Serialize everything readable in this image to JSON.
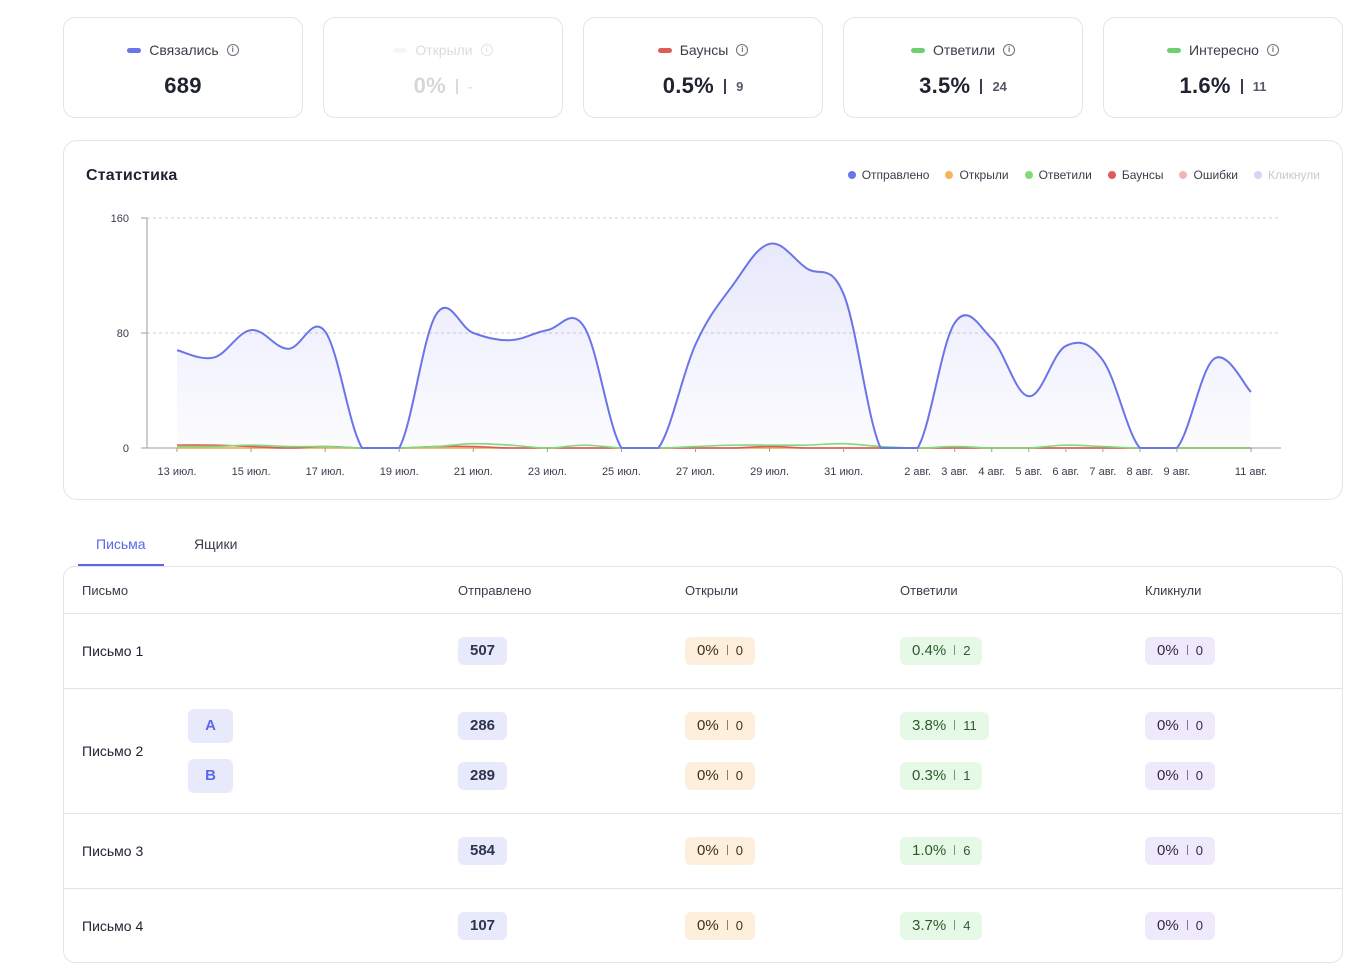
{
  "kpis": [
    {
      "label": "Связались",
      "value": "689",
      "count": "",
      "color": "#6b74e8",
      "faded": false
    },
    {
      "label": "Открыли",
      "value": "0%",
      "count": "-",
      "color": "#f3c8a8",
      "faded": true
    },
    {
      "label": "Баунсы",
      "value": "0.5%",
      "count": "9",
      "color": "#e05a5a",
      "faded": false
    },
    {
      "label": "Ответили",
      "value": "3.5%",
      "count": "24",
      "color": "#6fd06f",
      "faded": false
    },
    {
      "label": "Интересно",
      "value": "1.6%",
      "count": "11",
      "color": "#6fd06f",
      "faded": false
    }
  ],
  "chart": {
    "title": "Статистика",
    "legend": [
      {
        "label": "Отправлено",
        "color": "#6b74e8",
        "faded": false
      },
      {
        "label": "Открыли",
        "color": "#f5b35c",
        "faded": false
      },
      {
        "label": "Ответили",
        "color": "#7fdc74",
        "faded": false
      },
      {
        "label": "Баунсы",
        "color": "#e05a5a",
        "faded": false
      },
      {
        "label": "Ошибки",
        "color": "#f4b4b4",
        "faded": false
      },
      {
        "label": "Кликнули",
        "color": "#d9d4f5",
        "faded": true
      }
    ]
  },
  "chart_data": {
    "type": "area",
    "title": "Статистика",
    "xlabel": "",
    "ylabel": "",
    "ylim": [
      0,
      160
    ],
    "yticks": [
      "0",
      "80",
      "160"
    ],
    "grid": true,
    "legend_position": "top-right",
    "x": [
      "13 июл.",
      "14 июл.",
      "15 июл.",
      "16 июл.",
      "17 июл.",
      "18 июл.",
      "19 июл.",
      "20 июл.",
      "21 июл.",
      "22 июл.",
      "23 июл.",
      "24 июл.",
      "25 июл.",
      "26 июл.",
      "27 июл.",
      "28 июл.",
      "29 июл.",
      "30 июл.",
      "31 июл.",
      "1 авг.",
      "2 авг.",
      "3 авг.",
      "4 авг.",
      "5 авг.",
      "6 авг.",
      "7 авг.",
      "8 авг.",
      "9 авг.",
      "10 авг.",
      "11 авг."
    ],
    "xtick_labels": [
      "13 июл.",
      "15 июл.",
      "17 июл.",
      "19 июл.",
      "21 июл.",
      "23 июл.",
      "25 июл.",
      "27 июл.",
      "29 июл.",
      "31 июл.",
      "2 авг.",
      "3 авг.",
      "4 авг.",
      "5 авг.",
      "6 авг.",
      "7 авг.",
      "8 авг.",
      "9 авг.",
      "11 авг."
    ],
    "series": [
      {
        "name": "Отправлено",
        "color": "#6b74e8",
        "values": [
          68,
          63,
          82,
          69,
          81,
          0,
          0,
          93,
          80,
          75,
          82,
          84,
          0,
          0,
          72,
          113,
          142,
          125,
          107,
          0,
          0,
          87,
          76,
          36,
          71,
          61,
          0,
          0,
          62,
          39
        ]
      },
      {
        "name": "Открыли",
        "color": "#f5b35c",
        "values": [
          0,
          0,
          0,
          0,
          0,
          0,
          0,
          0,
          0,
          0,
          0,
          0,
          0,
          0,
          0,
          0,
          0,
          0,
          0,
          0,
          0,
          0,
          0,
          0,
          0,
          0,
          0,
          0,
          0,
          0
        ]
      },
      {
        "name": "Ответили",
        "color": "#7fdc74",
        "values": [
          1,
          1,
          2,
          1,
          1,
          0,
          0,
          1,
          3,
          2,
          0,
          2,
          0,
          0,
          1,
          2,
          2,
          2,
          3,
          1,
          0,
          1,
          0,
          0,
          2,
          1,
          0,
          0,
          0,
          0
        ]
      },
      {
        "name": "Баунсы",
        "color": "#e05a5a",
        "values": [
          2,
          2,
          1,
          0,
          1,
          0,
          0,
          1,
          1,
          0,
          0,
          0,
          0,
          0,
          0,
          0,
          1,
          0,
          0,
          0,
          0,
          0,
          0,
          0,
          0,
          0,
          0,
          0,
          0,
          0
        ]
      },
      {
        "name": "Ошибки",
        "color": "#f4b4b4",
        "values": [
          0,
          0,
          0,
          0,
          0,
          0,
          0,
          0,
          0,
          0,
          0,
          0,
          0,
          0,
          0,
          0,
          0,
          0,
          0,
          0,
          0,
          0,
          0,
          0,
          0,
          0,
          0,
          0,
          0,
          0
        ]
      },
      {
        "name": "Кликнули",
        "color": "#d9d4f5",
        "values": [
          0,
          0,
          0,
          0,
          0,
          0,
          0,
          0,
          0,
          0,
          0,
          0,
          0,
          0,
          0,
          0,
          0,
          0,
          0,
          0,
          0,
          0,
          0,
          0,
          0,
          0,
          0,
          0,
          0,
          0
        ]
      }
    ]
  },
  "tabs": [
    {
      "label": "Письма",
      "active": true
    },
    {
      "label": "Ящики",
      "active": false
    }
  ],
  "table": {
    "headers": [
      "Письмо",
      "Отправлено",
      "Открыли",
      "Ответили",
      "Кликнули"
    ],
    "rows": [
      {
        "name": "Письмо 1",
        "variants": [
          {
            "variant": "",
            "sent": "507",
            "opened_pct": "0%",
            "opened_cnt": "0",
            "replied_pct": "0.4%",
            "replied_cnt": "2",
            "clicked_pct": "0%",
            "clicked_cnt": "0"
          }
        ]
      },
      {
        "name": "Письмо 2",
        "variants": [
          {
            "variant": "A",
            "sent": "286",
            "opened_pct": "0%",
            "opened_cnt": "0",
            "replied_pct": "3.8%",
            "replied_cnt": "11",
            "clicked_pct": "0%",
            "clicked_cnt": "0"
          },
          {
            "variant": "B",
            "sent": "289",
            "opened_pct": "0%",
            "opened_cnt": "0",
            "replied_pct": "0.3%",
            "replied_cnt": "1",
            "clicked_pct": "0%",
            "clicked_cnt": "0"
          }
        ]
      },
      {
        "name": "Письмо 3",
        "variants": [
          {
            "variant": "",
            "sent": "584",
            "opened_pct": "0%",
            "opened_cnt": "0",
            "replied_pct": "1.0%",
            "replied_cnt": "6",
            "clicked_pct": "0%",
            "clicked_cnt": "0"
          }
        ]
      },
      {
        "name": "Письмо 4",
        "variants": [
          {
            "variant": "",
            "sent": "107",
            "opened_pct": "0%",
            "opened_cnt": "0",
            "replied_pct": "3.7%",
            "replied_cnt": "4",
            "clicked_pct": "0%",
            "clicked_cnt": "0"
          }
        ]
      }
    ]
  }
}
